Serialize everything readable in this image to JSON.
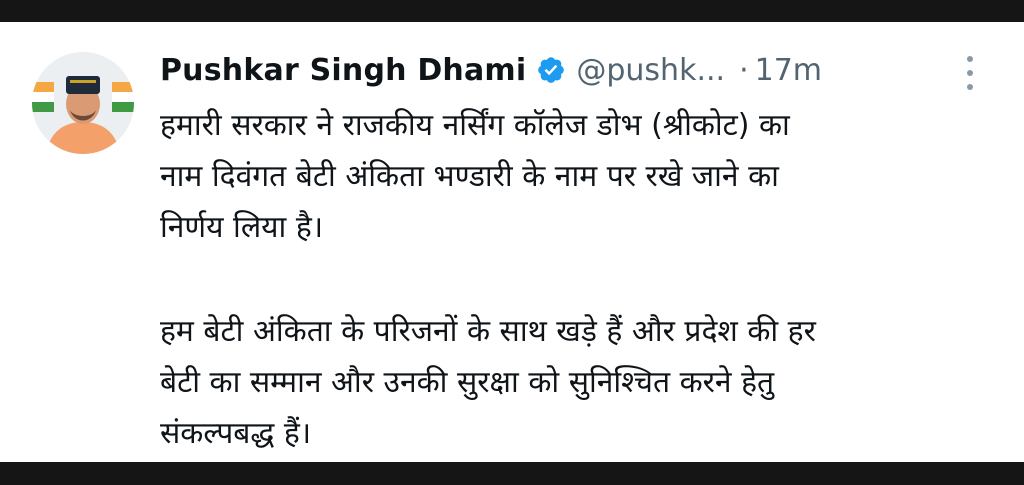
{
  "tweet": {
    "author_name": "Pushkar Singh Dhami",
    "handle": "@pushk...",
    "separator": "·",
    "time": "17m",
    "paragraphs": [
      [
        "हमारी सरकार ने राजकीय नर्सिंग कॉलेज डोभ (श्रीकोट) का",
        "नाम दिवंगत बेटी अंकिता भण्डारी के नाम पर रखे जाने का",
        "निर्णय लिया है।"
      ],
      [
        "हम बेटी अंकिता के परिजनों के साथ खड़े हैं और प्रदेश की हर",
        "बेटी का सम्मान और उनकी सुरक्षा को सुनिश्चित करने हेतु",
        "संकल्पबद्ध हैं।"
      ]
    ]
  },
  "icons": {
    "verified": "verified-badge-icon",
    "more": "more-options-icon"
  },
  "colors": {
    "text": "#0f1419",
    "muted": "#536471",
    "verified_blue": "#1d9bf0",
    "background": "#ffffff"
  }
}
